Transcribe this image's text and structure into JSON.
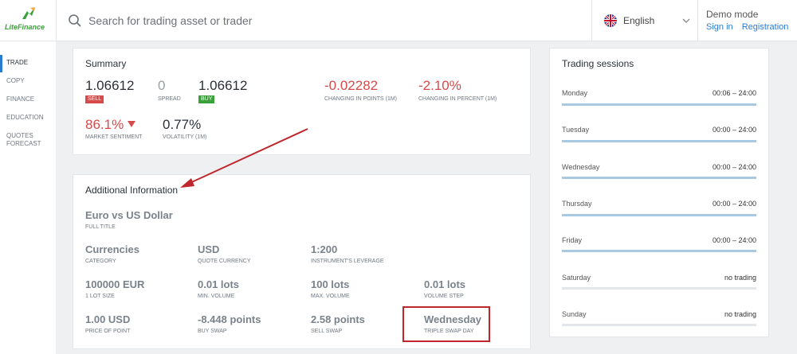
{
  "brand": {
    "name": "LiteFinance",
    "color": "#3aa13a"
  },
  "search": {
    "placeholder": "Search for trading asset or trader"
  },
  "language": {
    "label": "English"
  },
  "account": {
    "mode": "Demo mode",
    "signin": "Sign in",
    "registration": "Registration"
  },
  "sidebar": {
    "items": [
      {
        "label": "TRADE",
        "active": true
      },
      {
        "label": "COPY"
      },
      {
        "label": "FINANCE"
      },
      {
        "label": "EDUCATION"
      },
      {
        "label": "QUOTES FORECAST"
      }
    ]
  },
  "summary": {
    "title": "Summary",
    "sell": {
      "value": "1.06612",
      "badge": "SELL"
    },
    "spread": {
      "value": "0",
      "label": "SPREAD"
    },
    "buy": {
      "value": "1.06612",
      "badge": "BUY"
    },
    "change_points": {
      "value": "-0.02282",
      "label": "CHANGING IN POINTS (1M)"
    },
    "change_percent": {
      "value": "-2.10%",
      "label": "CHANGING IN PERCENT (1M)"
    },
    "sentiment": {
      "value": "86.1%",
      "label": "MARKET SENTIMENT"
    },
    "volatility": {
      "value": "0.77%",
      "label": "VOLATILITY (1M)"
    }
  },
  "additional": {
    "title": "Additional Information",
    "full_title": {
      "value": "Euro vs US Dollar",
      "label": "FULL TITLE"
    },
    "category": {
      "value": "Currencies",
      "label": "CATEGORY"
    },
    "quote_currency": {
      "value": "USD",
      "label": "QUOTE CURRENCY"
    },
    "leverage": {
      "value": "1:200",
      "label": "INSTRUMENT'S LEVERAGE"
    },
    "lot_size": {
      "value": "100000 EUR",
      "label": "1 LOT SIZE"
    },
    "min_volume": {
      "value": "0.01 lots",
      "label": "MIN. VOLUME"
    },
    "max_volume": {
      "value": "100 lots",
      "label": "MAX. VOLUME"
    },
    "volume_step": {
      "value": "0.01 lots",
      "label": "VOLUME STEP"
    },
    "price_of_point": {
      "value": "1.00 USD",
      "label": "PRICE OF POINT"
    },
    "buy_swap": {
      "value": "-8.448 points",
      "label": "BUY SWAP"
    },
    "sell_swap": {
      "value": "2.58 points",
      "label": "SELL SWAP"
    },
    "triple_swap": {
      "value": "Wednesday",
      "label": "TRIPLE SWAP DAY"
    }
  },
  "sessions": {
    "title": "Trading sessions",
    "days": [
      {
        "day": "Monday",
        "time": "00:06 – 24:00",
        "active": true
      },
      {
        "day": "Tuesday",
        "time": "00:00 – 24:00",
        "active": true
      },
      {
        "day": "Wednesday",
        "time": "00:00 – 24:00",
        "active": true
      },
      {
        "day": "Thursday",
        "time": "00:00 – 24:00",
        "active": true
      },
      {
        "day": "Friday",
        "time": "00:00 – 24:00",
        "active": true
      },
      {
        "day": "Saturday",
        "time": "no trading",
        "active": false
      },
      {
        "day": "Sunday",
        "time": "no trading",
        "active": false
      }
    ]
  },
  "colors": {
    "accent": "#2a7ccf",
    "sell": "#d64a4a",
    "buy": "#3aa13a",
    "highlight": "#c0272d",
    "session_bar": "#a9c8e2"
  }
}
